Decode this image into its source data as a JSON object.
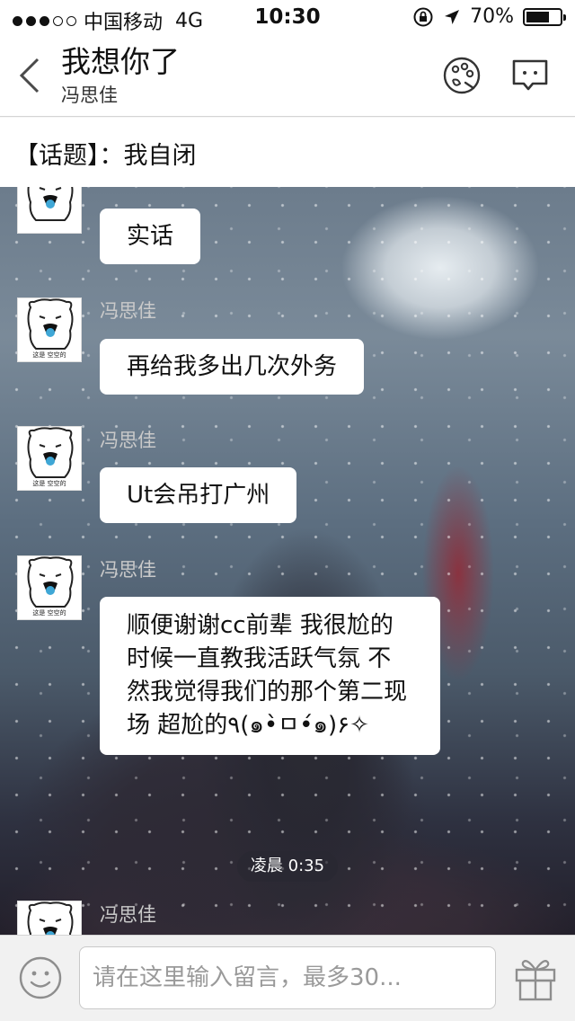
{
  "status_bar": {
    "carrier": "中国移动",
    "network": "4G",
    "time": "10:30",
    "battery": "70%",
    "battery_level": 0.7
  },
  "header": {
    "title": "我想你了",
    "subtitle": "冯思佳"
  },
  "topic": {
    "text": "【话题】：我自闭"
  },
  "messages": [
    {
      "sender": "",
      "text": "实话"
    },
    {
      "sender": "冯思佳",
      "text": "再给我多出几次外务"
    },
    {
      "sender": "冯思佳",
      "text": "Ut会吊打广州"
    },
    {
      "sender": "冯思佳",
      "text": "顺便谢谢cc前辈  我很尬的时候一直教我活跃气氛  不然我觉得我们的那个第二现场  超尬的٩(๑•̀ㅁ•́๑)۶✧"
    },
    {
      "sender": "冯思佳",
      "text": ""
    }
  ],
  "timestamp": "凌晨 0:35",
  "input": {
    "placeholder": "请在这里输入留言，最多30..."
  },
  "avatar_caption": "这是 空空的",
  "icons": {
    "back": "chevron-left-icon",
    "palette": "palette-icon",
    "message": "message-icon",
    "emoji": "emoji-icon",
    "gift": "gift-icon"
  }
}
